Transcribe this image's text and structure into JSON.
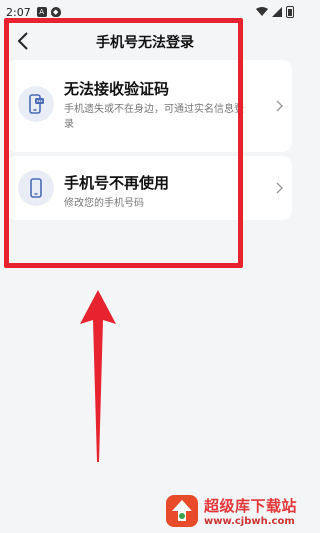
{
  "status_bar": {
    "time": "2:07",
    "icons": [
      "notification-icon",
      "shield-icon",
      "wifi-icon",
      "signal-icon",
      "battery-icon"
    ]
  },
  "header": {
    "title": "手机号无法登录",
    "back_icon": "chevron-left-icon"
  },
  "options": [
    {
      "title": "无法接收验证码",
      "description": "手机遗失或不在身边，可通过实名信息登录",
      "icon": "phone-message-icon"
    },
    {
      "title": "手机号不再使用",
      "description": "修改您的手机号码",
      "icon": "phone-icon"
    }
  ],
  "colors": {
    "accent_red": "#e6232f",
    "icon_blue": "#4a6bb5",
    "background": "#f4f5f7"
  },
  "watermark": {
    "title": "超级库下载站",
    "url": "www.cjbwh.com"
  }
}
